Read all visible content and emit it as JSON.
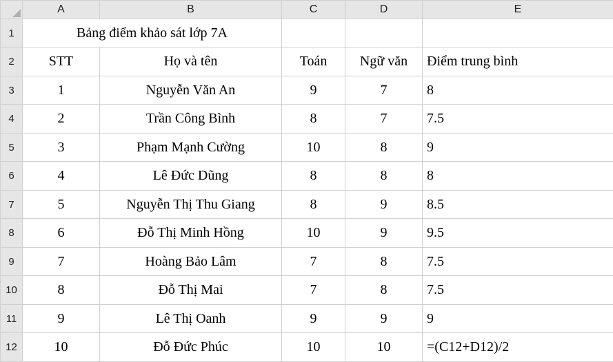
{
  "columns": [
    "A",
    "B",
    "C",
    "D",
    "E"
  ],
  "row_numbers": [
    "1",
    "2",
    "3",
    "4",
    "5",
    "6",
    "7",
    "8",
    "9",
    "10",
    "11",
    "12"
  ],
  "title_row": {
    "text": "Bảng điểm khảo sát lớp 7A"
  },
  "header_row": {
    "stt": "STT",
    "name": "Họ và tên",
    "math": "Toán",
    "lit": "Ngữ văn",
    "avg": "Điểm trung bình"
  },
  "data_rows": [
    {
      "stt": "1",
      "name": "Nguyễn Văn An",
      "math": "9",
      "lit": "7",
      "avg": "8"
    },
    {
      "stt": "2",
      "name": "Trần Công Bình",
      "math": "8",
      "lit": "7",
      "avg": "7.5"
    },
    {
      "stt": "3",
      "name": "Phạm Mạnh Cường",
      "math": "10",
      "lit": "8",
      "avg": "9"
    },
    {
      "stt": "4",
      "name": "Lê Đức Dũng",
      "math": "8",
      "lit": "8",
      "avg": "8"
    },
    {
      "stt": "5",
      "name": "Nguyễn Thị Thu Giang",
      "math": "8",
      "lit": "9",
      "avg": "8.5"
    },
    {
      "stt": "6",
      "name": "Đỗ Thị Minh Hồng",
      "math": "10",
      "lit": "9",
      "avg": "9.5"
    },
    {
      "stt": "7",
      "name": "Hoàng Bảo Lâm",
      "math": "7",
      "lit": "8",
      "avg": "7.5"
    },
    {
      "stt": "8",
      "name": "Đỗ Thị Mai",
      "math": "7",
      "lit": "8",
      "avg": "7.5"
    },
    {
      "stt": "9",
      "name": "Lê Thị Oanh",
      "math": "9",
      "lit": "9",
      "avg": "9"
    },
    {
      "stt": "10",
      "name": "Đỗ Đức Phúc",
      "math": "10",
      "lit": "10",
      "avg": "=(C12+D12)/2"
    }
  ]
}
